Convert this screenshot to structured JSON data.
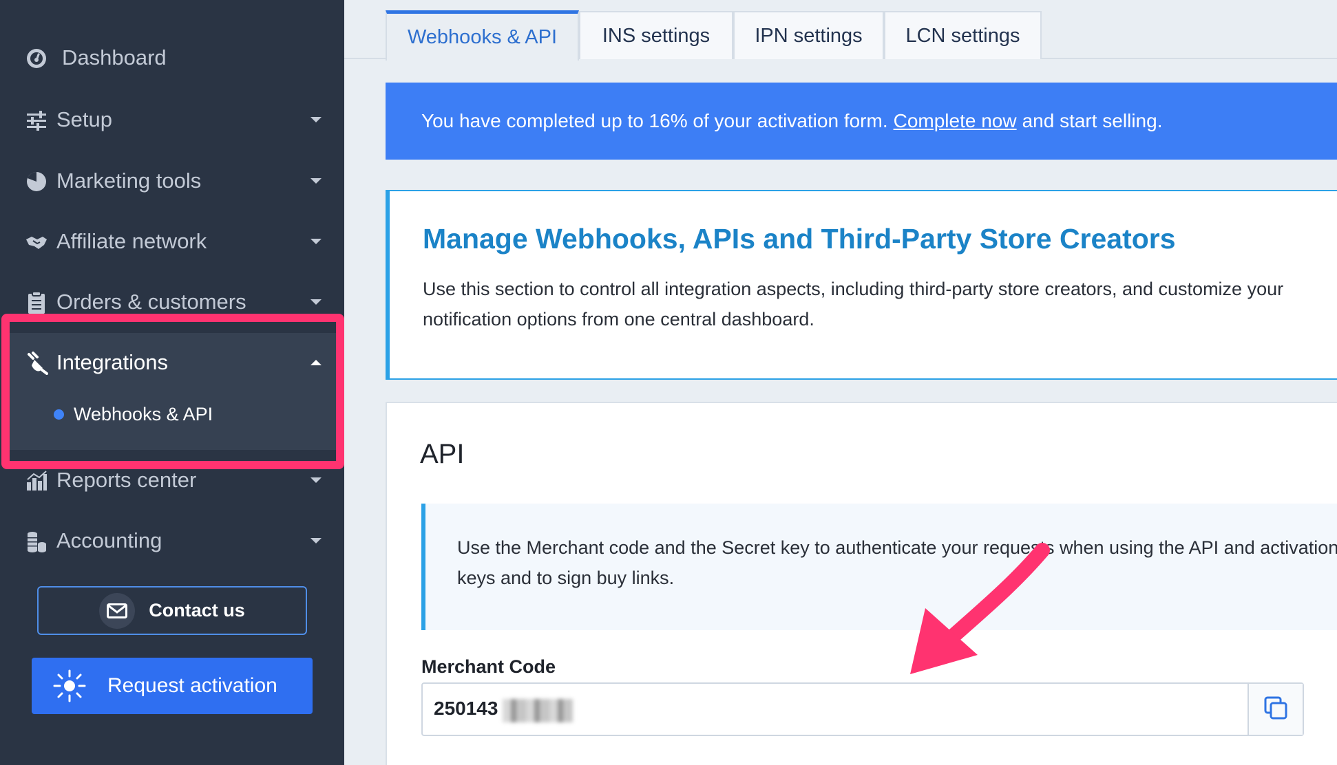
{
  "sidebar": {
    "items": [
      {
        "label": "Dashboard",
        "icon": "gauge-icon"
      },
      {
        "label": "Setup",
        "icon": "sliders-icon"
      },
      {
        "label": "Marketing tools",
        "icon": "pie-chart-icon"
      },
      {
        "label": "Affiliate network",
        "icon": "handshake-icon"
      },
      {
        "label": "Orders & customers",
        "icon": "clipboard-icon"
      },
      {
        "label": "Integrations",
        "icon": "plug-icon"
      },
      {
        "label": "Reports center",
        "icon": "bar-chart-icon"
      },
      {
        "label": "Accounting",
        "icon": "coins-icon"
      }
    ],
    "integrations_sub": [
      {
        "label": "Webhooks & API"
      }
    ],
    "contact_label": "Contact us",
    "activation_label": "Request activation"
  },
  "tabs": [
    {
      "label": "Webhooks & API"
    },
    {
      "label": "INS settings"
    },
    {
      "label": "IPN settings"
    },
    {
      "label": "LCN settings"
    }
  ],
  "banner": {
    "text_before": "You have completed up to 16% of your activation form.",
    "link": "Complete now",
    "text_after": "and start selling."
  },
  "intro": {
    "title": "Manage Webhooks, APIs and Third-Party Store Creators",
    "description": "Use this section to control all integration aspects, including third-party store creators, and customize your notification options from one central dashboard."
  },
  "api": {
    "title": "API",
    "note": "Use the Merchant code and the Secret key to authenticate your requests when using the API and activation keys and to sign buy links.",
    "merchant_label": "Merchant Code",
    "merchant_value": "250143"
  },
  "colors": {
    "sidebar_bg": "#2a3444",
    "accent_blue": "#3d7ef5",
    "title_blue": "#1b83c7",
    "highlight_pink": "#ff3370"
  }
}
